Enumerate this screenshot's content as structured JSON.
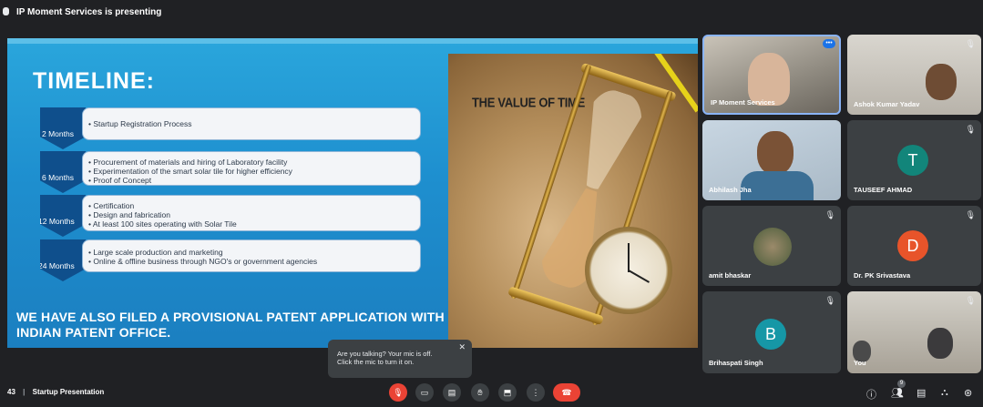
{
  "topbar": {
    "presenting": "IP Moment Services is presenting"
  },
  "slide": {
    "title": "TIMELINE:",
    "rows": [
      {
        "period": "2 Months",
        "items": [
          "Startup Registration Process"
        ]
      },
      {
        "period": "6 Months",
        "items": [
          "Procurement of materials and hiring of Laboratory facility",
          "Experimentation of the smart solar tile for higher efficiency",
          "Proof of Concept"
        ]
      },
      {
        "period": "12 Months",
        "items": [
          "Certification",
          "Design and fabrication",
          "At least 100 sites operating with Solar Tile"
        ]
      },
      {
        "period": "24 Months",
        "items": [
          "Large scale production and marketing",
          "Online & offline business through NGO's or government agencies"
        ]
      }
    ],
    "patent_line1": "WE HAVE ALSO FILED A PROVISIONAL PATENT APPLICATION WITH THE",
    "patent_line2": "INDIAN PATENT OFFICE.",
    "image_caption": "THE VALUE OF TIME"
  },
  "participants": [
    {
      "name": "IP Moment Services",
      "initial": "",
      "color": ""
    },
    {
      "name": "Ashok Kumar Yadav",
      "initial": "",
      "color": ""
    },
    {
      "name": "Abhilash Jha",
      "initial": "",
      "color": ""
    },
    {
      "name": "TAUSEEF AHMAD",
      "initial": "T",
      "color": "#12857a"
    },
    {
      "name": "amit bhaskar",
      "initial": "",
      "color": ""
    },
    {
      "name": "Dr. PK Srivastava",
      "initial": "D",
      "color": "#e8542a"
    },
    {
      "name": "Brihaspati Singh",
      "initial": "B",
      "color": "#1697a6"
    },
    {
      "name": "You",
      "initial": "",
      "color": ""
    }
  ],
  "popup": {
    "line1": "Are you talking? Your mic is off.",
    "line2": "Click the mic to turn it on."
  },
  "bottombar": {
    "meeting_time": "43",
    "meeting_name": "Startup Presentation",
    "people_count": "9"
  },
  "icons": [
    "mic-off-icon",
    "camera-icon",
    "captions-icon",
    "raise-hand-icon",
    "present-icon",
    "more-icon",
    "end-call-icon",
    "info-icon",
    "people-icon",
    "chat-icon",
    "activities-icon",
    "host-controls-icon"
  ]
}
